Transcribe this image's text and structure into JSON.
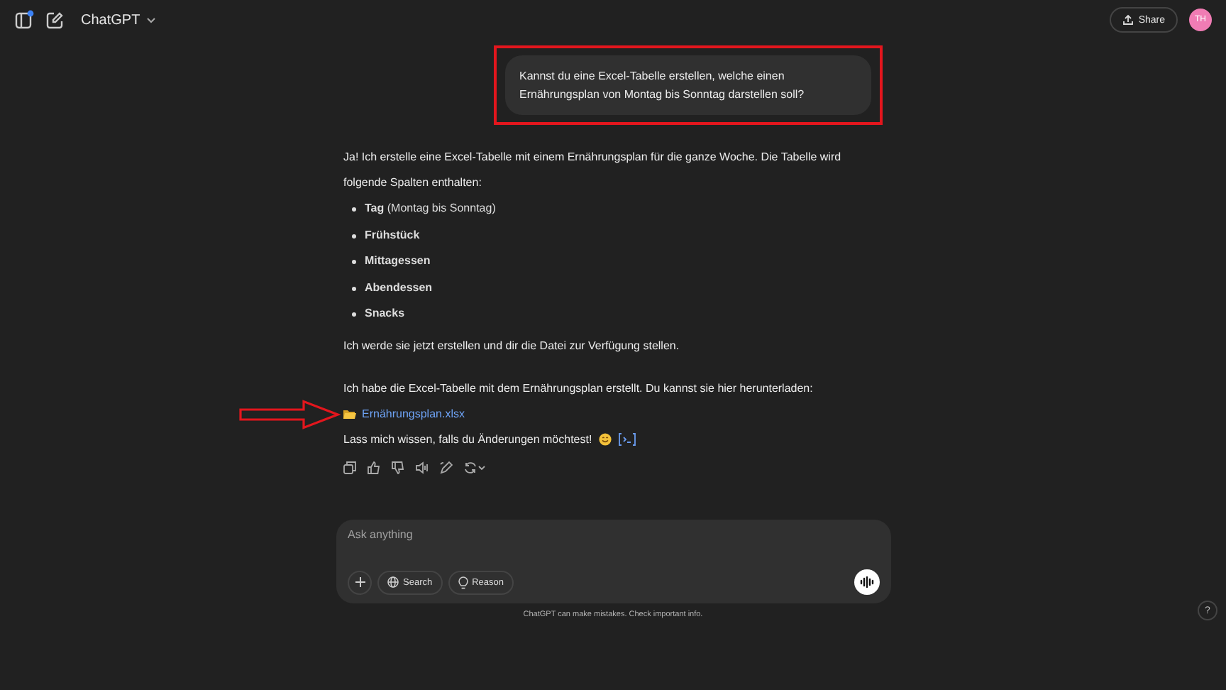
{
  "header": {
    "title": "ChatGPT",
    "share": "Share",
    "avatar": "TH",
    "sidebar_badge": true
  },
  "user_message": {
    "text": "Kannst du eine Excel-Tabelle erstellen, welche einen Ernährungsplan von Montag bis Sonntag darstellen soll?",
    "highlighted": true
  },
  "response": {
    "intro": "Ja! Ich erstelle eine Excel-Tabelle mit einem Ernährungsplan für die ganze Woche. Die Tabelle wird folgende Spalten enthalten:",
    "bullets": [
      {
        "text": "**Tag** (Montag bis Sonntag)",
        "bold": false
      },
      {
        "text": "Frühstück",
        "bold": true
      },
      {
        "text": "Mittagessen",
        "bold": true
      },
      {
        "text": "Abendessen",
        "bold": true
      },
      {
        "text": "Snacks",
        "bold": true
      }
    ],
    "paragraph_1": "Ich werde sie jetzt erstellen und dir die Datei zur Verfügung stellen.",
    "paragraph_2": "Ich habe die Excel-Tabelle mit dem Ernährungsplan erstellt. Du kannst sie hier herunterladen:",
    "file_link": {
      "text": "Ernährungsplan.xlsx",
      "marked": true
    },
    "closing": "Lass mich wissen, falls du Änderungen möchtest!"
  },
  "composer": {
    "placeholder": "Ask anything",
    "buttons": [
      {
        "kind": "plus"
      },
      {
        "kind": "search",
        "label": "Search"
      },
      {
        "kind": "reason",
        "label": "Reason"
      }
    ]
  },
  "footer": "ChatGPT can make mistakes. Check important info.",
  "help": "?"
}
